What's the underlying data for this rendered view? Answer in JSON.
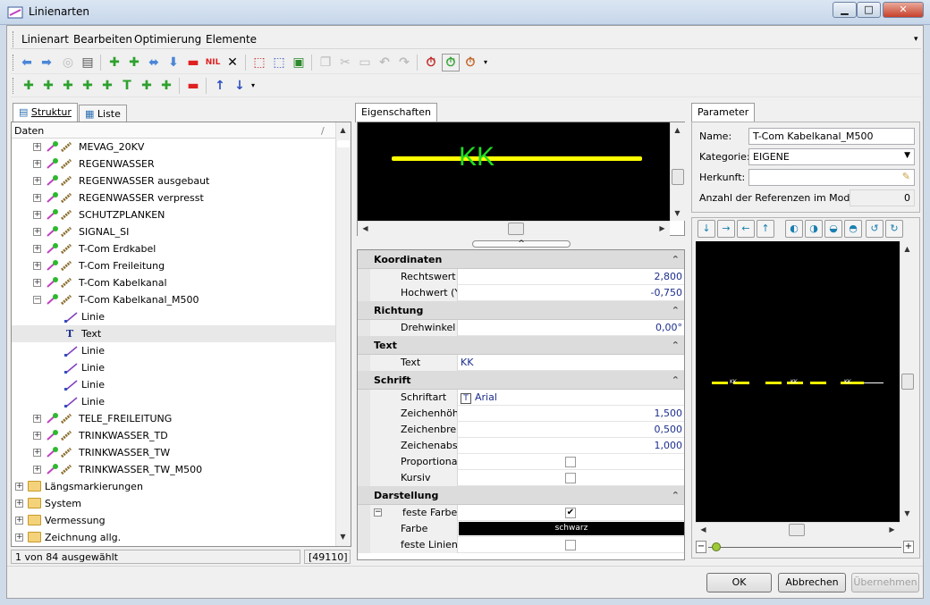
{
  "window": {
    "title": "Linienarten"
  },
  "menu": [
    "Linienart",
    "Bearbeiten",
    "Optimierung",
    "Elemente"
  ],
  "left": {
    "tabs": [
      "Struktur",
      "Liste"
    ],
    "header": "Daten",
    "header_sort": "/",
    "tree": [
      {
        "label": "MEVAG_20KV",
        "level": 1,
        "type": "linetype",
        "exp": "+"
      },
      {
        "label": "REGENWASSER",
        "level": 1,
        "type": "linetype",
        "exp": "+"
      },
      {
        "label": "REGENWASSER ausgebaut",
        "level": 1,
        "type": "linetype",
        "exp": "+"
      },
      {
        "label": "REGENWASSER verpresst",
        "level": 1,
        "type": "linetype",
        "exp": "+"
      },
      {
        "label": "SCHUTZPLANKEN",
        "level": 1,
        "type": "linetype",
        "exp": "+"
      },
      {
        "label": "SIGNAL_SI",
        "level": 1,
        "type": "linetype",
        "exp": "+"
      },
      {
        "label": "T-Com Erdkabel",
        "level": 1,
        "type": "linetype",
        "exp": "+"
      },
      {
        "label": "T-Com Freileitung",
        "level": 1,
        "type": "linetype",
        "exp": "+"
      },
      {
        "label": "T-Com Kabelkanal",
        "level": 1,
        "type": "linetype",
        "exp": "+"
      },
      {
        "label": "T-Com Kabelkanal_M500",
        "level": 1,
        "type": "linetype",
        "exp": "−"
      },
      {
        "label": "Linie",
        "level": 2,
        "type": "line"
      },
      {
        "label": "Text",
        "level": 2,
        "type": "text",
        "selected": true
      },
      {
        "label": "Linie",
        "level": 2,
        "type": "line"
      },
      {
        "label": "Linie",
        "level": 2,
        "type": "line"
      },
      {
        "label": "Linie",
        "level": 2,
        "type": "line"
      },
      {
        "label": "Linie",
        "level": 2,
        "type": "line"
      },
      {
        "label": "TELE_FREILEITUNG",
        "level": 1,
        "type": "linetype",
        "exp": "+"
      },
      {
        "label": "TRINKWASSER_TD",
        "level": 1,
        "type": "linetype",
        "exp": "+"
      },
      {
        "label": "TRINKWASSER_TW",
        "level": 1,
        "type": "linetype",
        "exp": "+"
      },
      {
        "label": "TRINKWASSER_TW_M500",
        "level": 1,
        "type": "linetype",
        "exp": "+"
      },
      {
        "label": "Längsmarkierungen",
        "level": 0,
        "type": "folder",
        "exp": "+"
      },
      {
        "label": "System",
        "level": 0,
        "type": "folder",
        "exp": "+"
      },
      {
        "label": "Vermessung",
        "level": 0,
        "type": "folder",
        "exp": "+"
      },
      {
        "label": "Zeichnung allg.",
        "level": 0,
        "type": "folder",
        "exp": "+"
      }
    ],
    "status": "1 von 84 ausgewählt",
    "status_count": "[49110]"
  },
  "mid": {
    "tab": "Eigenschaften",
    "preview_text": "KK",
    "sections": [
      {
        "title": "Koordinaten",
        "rows": [
          {
            "name": "Rechtswert (X)",
            "value": "2,800"
          },
          {
            "name": "Hochwert (Y)",
            "value": "-0,750"
          }
        ]
      },
      {
        "title": "Richtung",
        "rows": [
          {
            "name": "Drehwinkel",
            "value": "0,00°"
          }
        ]
      },
      {
        "title": "Text",
        "rows": [
          {
            "name": "Text",
            "value": "KK",
            "align": "left"
          }
        ]
      },
      {
        "title": "Schrift",
        "rows": [
          {
            "name": "Schriftart",
            "value": "Arial",
            "font": true
          },
          {
            "name": "Zeichenhöhe",
            "value": "1,500"
          },
          {
            "name": "Zeichenbreite",
            "value": "0,500"
          },
          {
            "name": "Zeichenabstand",
            "value": "1,000"
          },
          {
            "name": "Proportional",
            "check": false
          },
          {
            "name": "Kursiv",
            "check": false
          }
        ]
      },
      {
        "title": "Darstellung",
        "rows": [
          {
            "name": "feste Farbe",
            "check": true,
            "collapse": "−"
          },
          {
            "name": "Farbe",
            "color": "schwarz"
          },
          {
            "name": "feste Linienbreit",
            "check": false
          }
        ]
      }
    ]
  },
  "right": {
    "tab": "Parameter",
    "name_label": "Name:",
    "name_value": "T-Com Kabelkanal_M500",
    "kategorie_label": "Kategorie:",
    "kategorie_value": "EIGENE",
    "herkunft_label": "Herkunft:",
    "herkunft_value": "",
    "refs_label": "Anzahl der Referenzen im Modell:",
    "refs_value": "0",
    "preview_label": "KK"
  },
  "buttons": {
    "ok": "OK",
    "cancel": "Abbrechen",
    "apply": "Übernehmen"
  },
  "colors": {
    "yellow": "#ffff00",
    "green": "#22dd22",
    "select": "#e8e8e8"
  }
}
